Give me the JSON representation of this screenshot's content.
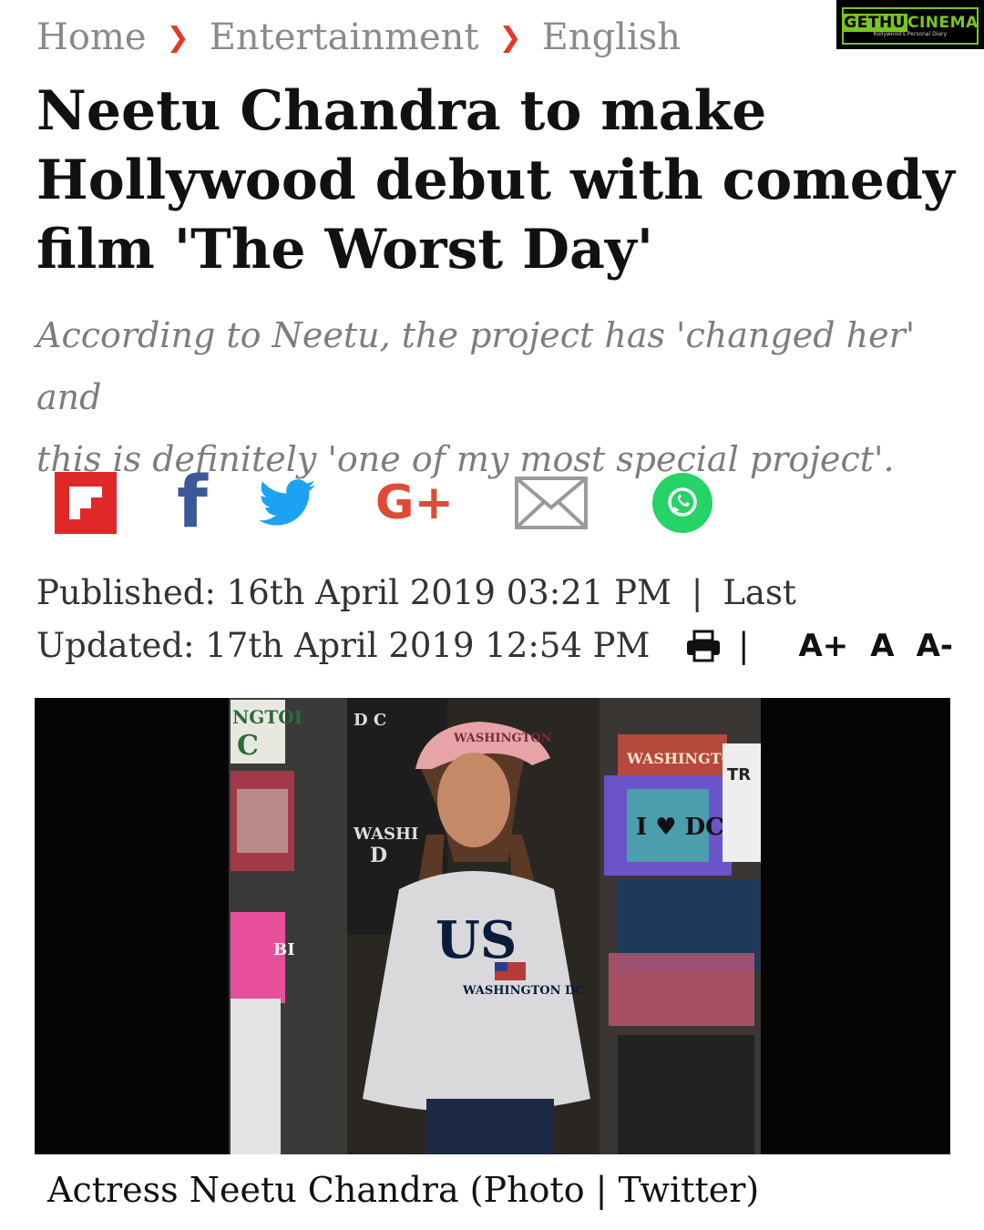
{
  "breadcrumb": {
    "items": [
      "Home",
      "Entertainment",
      "English"
    ]
  },
  "logo": {
    "part1": "GETHU",
    "part2": "CINEMA",
    "tagline": "Kollywood's Personal Diary"
  },
  "article": {
    "headline_line1": "Neetu Chandra to make",
    "headline_line2": "Hollywood debut with comedy",
    "headline_line3": "film 'The Worst Day'",
    "summary_line1": "According to Neetu, the project has 'changed her' and",
    "summary_line2": "this is definitely 'one of my most special project'.",
    "published": "Published: 16th April 2019 03:21 PM",
    "last": "Last",
    "updated": "Updated: 17th April 2019 12:54 PM",
    "caption": "Actress Neetu Chandra (Photo | Twitter)"
  },
  "share": {
    "icons": [
      "flipboard-icon",
      "facebook-icon",
      "twitter-icon",
      "google-plus-icon",
      "email-icon",
      "whatsapp-icon"
    ],
    "googleplus_label": "G+",
    "facebook_label": "f"
  },
  "tools": {
    "separator": "|",
    "font_increase": "A+",
    "font_normal": "A",
    "font_decrease": "A-"
  },
  "photo": {
    "cap_text": "WASHINGTON",
    "shirt_text": "US",
    "shirt_sub": "WASHINGTON DC",
    "stall_left_top": "NGTOI",
    "stall_left_c": "C",
    "stall_dc": "D C",
    "stall_wash": "WASHI",
    "stall_d": "D",
    "stall_bi": "BI",
    "stall_tr": "TR",
    "stall_i_dc": "I ♥ DC",
    "stall_washington_right": "WASHINGTON"
  },
  "colors": {
    "flipboard": "#e12828",
    "facebook": "#3b5998",
    "twitter": "#1da1f2",
    "googleplus": "#dd4b39",
    "email": "#9a9a9a",
    "whatsapp": "#25d366",
    "breadcrumb_sep": "#e23a2a",
    "logo_green": "#7ac520"
  }
}
